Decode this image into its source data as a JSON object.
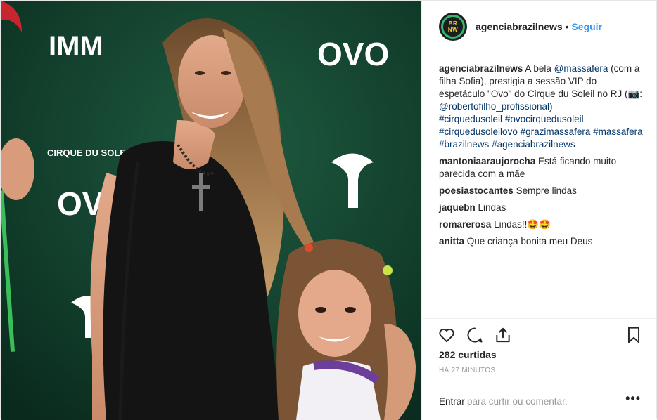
{
  "header": {
    "avatar_monogram": "BR\nNW",
    "username": "agenciabrazilnews",
    "separator": "•",
    "follow": "Seguir"
  },
  "caption": {
    "username": "agenciabrazilnews",
    "text_1": "A bela",
    "mention_1": "@massafera",
    "text_2": "(com a filha Sofia), prestigia a sessão VIP do espetáculo \"Ovo\" do Cirque du Soleil no RJ (",
    "camera_emoji": "📷",
    "text_3": ":",
    "mention_2": "@robertofilho_profissional",
    "text_4": ")",
    "hashtags": [
      "#cirquedusoleil",
      "#ovocirquedusoleil",
      "#cirquedusoleilovo",
      "#grazimassafera",
      "#massafera",
      "#brazilnews",
      "#agenciabrazilnews"
    ]
  },
  "comments": [
    {
      "user": "mantoniaaraujorocha",
      "text": "Está ficando muito parecida com a mãe"
    },
    {
      "user": "poesiastocantes",
      "text": "Sempre lindas"
    },
    {
      "user": "jaquebn",
      "text": "Lindas"
    },
    {
      "user": "romarerosa",
      "text": "Lindas!!🤩🤩"
    },
    {
      "user": "anitta",
      "text": "Que criança bonita meu Deus"
    }
  ],
  "actions": {
    "like_icon": "heart-icon",
    "comment_icon": "speech-bubble-icon",
    "share_icon": "share-icon",
    "save_icon": "bookmark-icon"
  },
  "likes": "282 curtidas",
  "time_ago": "HÁ 27 MINUTOS",
  "add_comment": {
    "enter": "Entrar",
    "placeholder": "para curtir ou comentar.",
    "more": "•••"
  },
  "photo": {
    "logo_imm": "IMM",
    "logo_ovo_1": "OVO",
    "logo_ovo_2": "OVO",
    "logo_cirque": "CIRQUE DU SOLEIL"
  },
  "colors": {
    "link": "#3897f0",
    "hashtag": "#003569",
    "backdrop": "#0e3a2a"
  }
}
